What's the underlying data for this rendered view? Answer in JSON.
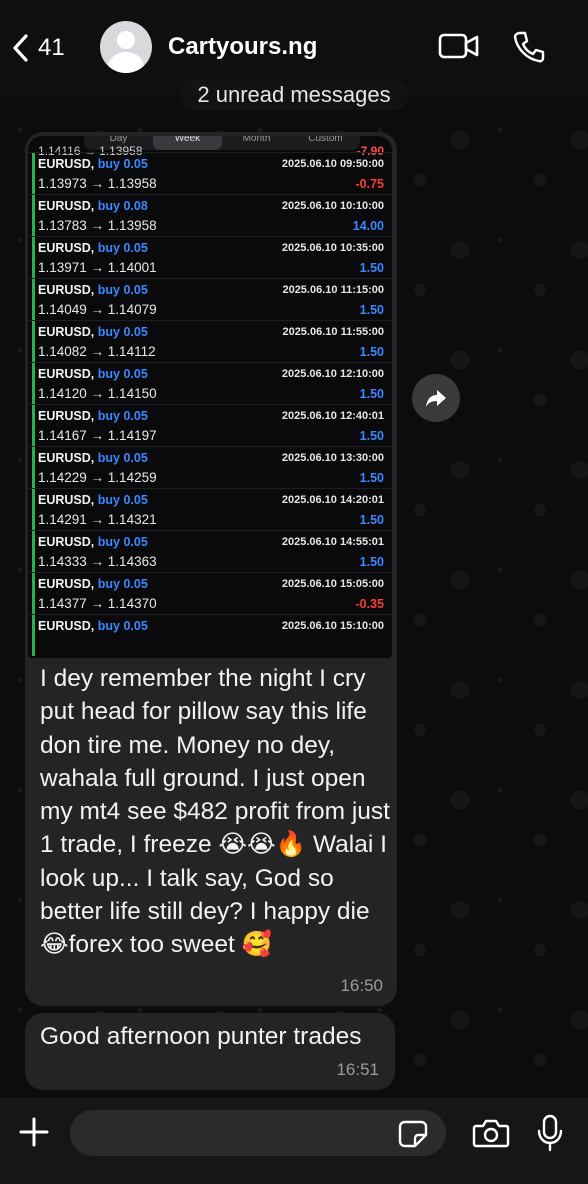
{
  "header": {
    "back_count": "41",
    "contact_name": "Cartyours.ng"
  },
  "unread_banner": "2 unread messages",
  "media_message": {
    "screenshot": {
      "segments": [
        "Day",
        "Week",
        "Month",
        "Custom"
      ],
      "active_segment": "Week",
      "clipped_row": {
        "prices": "1.14116 → 1.13958",
        "profit": "-7.90"
      },
      "trades": [
        {
          "symbol": "EURUSD,",
          "direction": "buy 0.05",
          "prices": "1.13973 → 1.13958",
          "time": "2025.06.10 09:50:00",
          "profit": "-0.75",
          "sign": "neg"
        },
        {
          "symbol": "EURUSD,",
          "direction": "buy 0.08",
          "prices": "1.13783 → 1.13958",
          "time": "2025.06.10 10:10:00",
          "profit": "14.00",
          "sign": "pos"
        },
        {
          "symbol": "EURUSD,",
          "direction": "buy 0.05",
          "prices": "1.13971 → 1.14001",
          "time": "2025.06.10 10:35:00",
          "profit": "1.50",
          "sign": "pos"
        },
        {
          "symbol": "EURUSD,",
          "direction": "buy 0.05",
          "prices": "1.14049 → 1.14079",
          "time": "2025.06.10 11:15:00",
          "profit": "1.50",
          "sign": "pos"
        },
        {
          "symbol": "EURUSD,",
          "direction": "buy 0.05",
          "prices": "1.14082 → 1.14112",
          "time": "2025.06.10 11:55:00",
          "profit": "1.50",
          "sign": "pos"
        },
        {
          "symbol": "EURUSD,",
          "direction": "buy 0.05",
          "prices": "1.14120 → 1.14150",
          "time": "2025.06.10 12:10:00",
          "profit": "1.50",
          "sign": "pos"
        },
        {
          "symbol": "EURUSD,",
          "direction": "buy 0.05",
          "prices": "1.14167 → 1.14197",
          "time": "2025.06.10 12:40:01",
          "profit": "1.50",
          "sign": "pos"
        },
        {
          "symbol": "EURUSD,",
          "direction": "buy 0.05",
          "prices": "1.14229 → 1.14259",
          "time": "2025.06.10 13:30:00",
          "profit": "1.50",
          "sign": "pos"
        },
        {
          "symbol": "EURUSD,",
          "direction": "buy 0.05",
          "prices": "1.14291 → 1.14321",
          "time": "2025.06.10 14:20:01",
          "profit": "1.50",
          "sign": "pos"
        },
        {
          "symbol": "EURUSD,",
          "direction": "buy 0.05",
          "prices": "1.14333 → 1.14363",
          "time": "2025.06.10 14:55:01",
          "profit": "1.50",
          "sign": "pos"
        },
        {
          "symbol": "EURUSD,",
          "direction": "buy 0.05",
          "prices": "1.14377 → 1.14370",
          "time": "2025.06.10 15:05:00",
          "profit": "-0.35",
          "sign": "neg"
        },
        {
          "symbol": "EURUSD,",
          "direction": "buy 0.05",
          "prices": "",
          "time": "2025.06.10 15:10:00",
          "profit": "",
          "sign": "pos"
        }
      ]
    },
    "caption": "I dey remember the night I cry put head for pillow say this life don tire me. Money no dey, wahala full ground. I just open my mt4 see $482 profit from just 1 trade, I freeze 😭😭🔥 Walai I look up... I talk say, God so better life still dey? I happy die 😂forex too sweet 🥰",
    "time": "16:50"
  },
  "text_message": {
    "text": "Good afternoon punter trades",
    "time": "16:51"
  },
  "input_bar": {
    "placeholder": ""
  },
  "colors": {
    "bubble": "#242424",
    "profit_positive": "#3a88ff",
    "profit_negative": "#ff3b30",
    "trade_marker": "#27b34a"
  }
}
